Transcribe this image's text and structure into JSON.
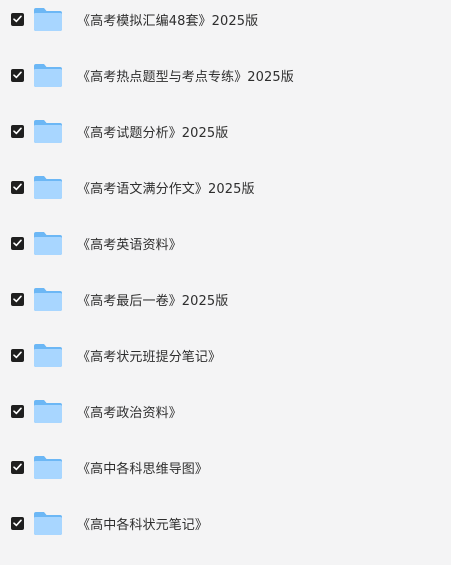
{
  "colors": {
    "background": "#f4f4f5",
    "checkbox": "#1f1f1f",
    "folder_light": "#a8d6ff",
    "folder_dark": "#6cb7f5",
    "text": "#2e2e2e"
  },
  "items": [
    {
      "name": "《高考模拟汇编48套》2025版",
      "checked": true,
      "icon": "folder-icon"
    },
    {
      "name": "《高考热点题型与考点专练》2025版",
      "checked": true,
      "icon": "folder-icon"
    },
    {
      "name": "《高考试题分析》2025版",
      "checked": true,
      "icon": "folder-icon"
    },
    {
      "name": "《高考语文满分作文》2025版",
      "checked": true,
      "icon": "folder-icon"
    },
    {
      "name": "《高考英语资料》",
      "checked": true,
      "icon": "folder-icon"
    },
    {
      "name": "《高考最后一卷》2025版",
      "checked": true,
      "icon": "folder-icon"
    },
    {
      "name": "《高考状元班提分笔记》",
      "checked": true,
      "icon": "folder-icon"
    },
    {
      "name": "《高考政治资料》",
      "checked": true,
      "icon": "folder-icon"
    },
    {
      "name": "《高中各科思维导图》",
      "checked": true,
      "icon": "folder-icon"
    },
    {
      "name": "《高中各科状元笔记》",
      "checked": true,
      "icon": "folder-icon"
    }
  ]
}
